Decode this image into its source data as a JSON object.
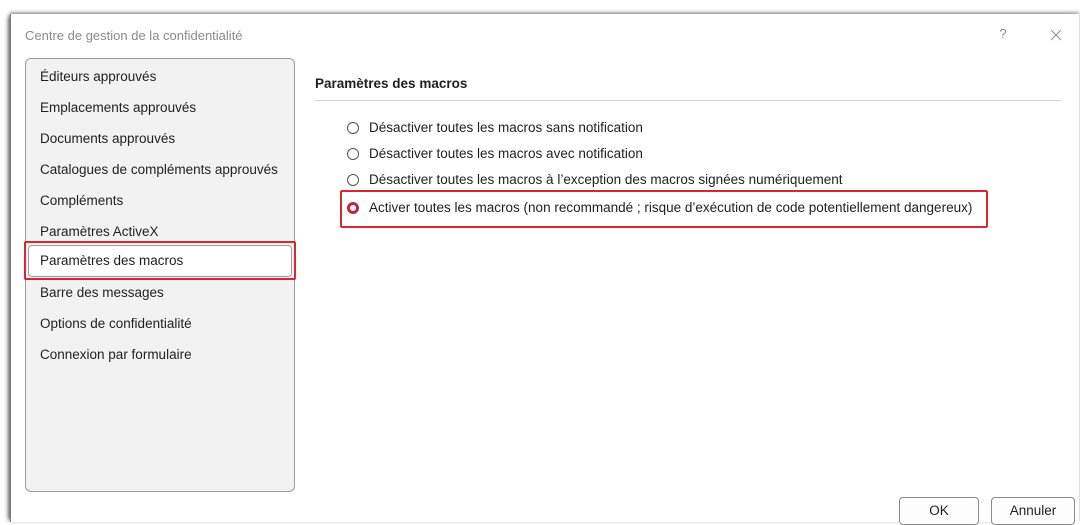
{
  "window": {
    "title": "Centre de gestion de la confidentialité",
    "help_label": "?",
    "close_icon": "close-icon"
  },
  "sidebar": {
    "items": [
      {
        "label": "Éditeurs approuvés"
      },
      {
        "label": "Emplacements approuvés"
      },
      {
        "label": "Documents approuvés"
      },
      {
        "label": "Catalogues de compléments approuvés"
      },
      {
        "label": "Compléments"
      },
      {
        "label": "Paramètres ActiveX"
      },
      {
        "label": "Paramètres des macros",
        "selected": true
      },
      {
        "label": "Barre des messages"
      },
      {
        "label": "Options de confidentialité"
      },
      {
        "label": "Connexion par formulaire"
      }
    ]
  },
  "main": {
    "section_title": "Paramètres des macros",
    "options": [
      {
        "label": "Désactiver toutes les macros sans notification",
        "checked": false
      },
      {
        "label": "Désactiver toutes les macros avec notification",
        "checked": false
      },
      {
        "label": "Désactiver toutes les macros à l’exception des macros signées numériquement",
        "checked": false
      },
      {
        "label": "Activer toutes les macros (non recommandé ; risque d’exécution de code potentiellement dangereux)",
        "checked": true
      }
    ]
  },
  "footer": {
    "ok_label": "OK",
    "cancel_label": "Annuler"
  },
  "colors": {
    "highlight": "#d9262f",
    "radio_checked": "#c0283b"
  }
}
